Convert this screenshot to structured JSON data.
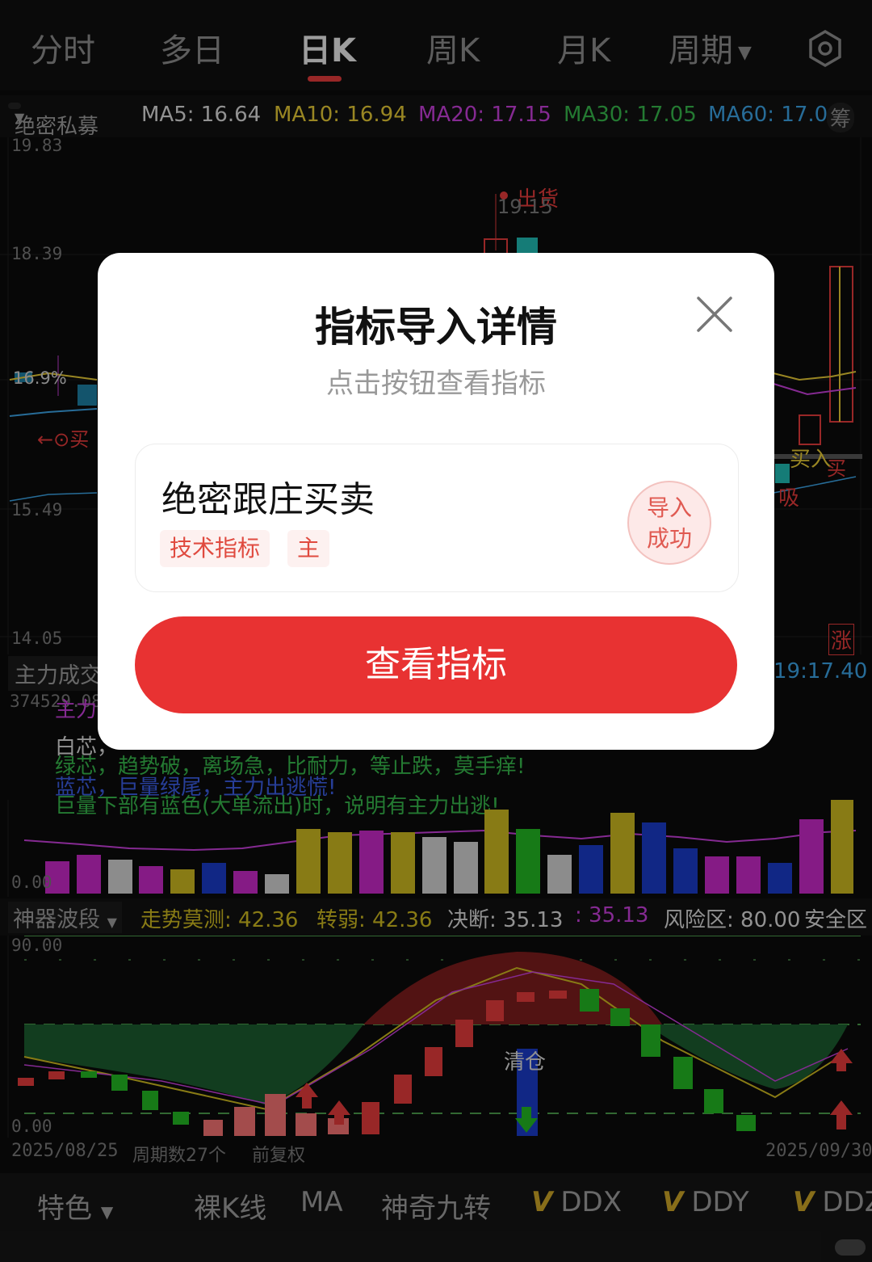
{
  "top_tabs": [
    {
      "label": "分时"
    },
    {
      "label": "多日"
    },
    {
      "label": "日K"
    },
    {
      "label": "周K"
    },
    {
      "label": "月K"
    },
    {
      "label": "周期"
    }
  ],
  "active_tab": "日K",
  "indicator_row": {
    "selector": "绝密私募",
    "ma5": "MA5: 16.64",
    "ma10": "MA10: 16.94",
    "ma20": "MA20: 17.15",
    "ma30": "MA30: 17.05",
    "ma60": "MA60: 17.0",
    "chip": "筹"
  },
  "price_axis": [
    "19.83",
    "18.39",
    "15.49",
    "14.05"
  ],
  "price_annotations": {
    "sell_top": "出货",
    "high_price": "19.15",
    "buy_left": "←⊙买",
    "buy_right": "买入",
    "buy_right2": "买",
    "absorb": "吸",
    "rise_icon": "涨",
    "left_price": "16.9%"
  },
  "volume_panel": {
    "title": "主力成交",
    "value_left": "374529.08",
    "time_right": "19:17.40",
    "zero_label": "0.00",
    "legend_lines": [
      "主力 粉芯",
      "白芯，",
      "绿芯，趋势破，离场急，比耐力，等止跌，莫手痒!",
      "蓝芯，巨量绿尾，主力出逃慌!",
      "巨量下部有蓝色(大单流出)时，说明有主力出逃!"
    ]
  },
  "wave_panel": {
    "selector": "神器波段",
    "items": [
      "走势莫测: 42.36",
      "转弱: 42.36",
      "决断: 35.13",
      ": 35.13",
      "风险区: 80.00",
      "安全区"
    ],
    "axis_top": "90.00",
    "axis_bottom": "0.00",
    "clear_label": "清仓"
  },
  "date_row": {
    "start": "2025/08/25",
    "period_count": "周期数27个",
    "adjust": "前复权",
    "end": "2025/09/30"
  },
  "bottom_bar": {
    "feature": "特色",
    "items": [
      "裸K线",
      "MA",
      "神奇九转"
    ],
    "v_items": [
      "DDX",
      "DDY",
      "DDZ"
    ],
    "v_mark": "V"
  },
  "modal": {
    "title": "指标导入详情",
    "subtitle": "点击按钮查看指标",
    "indicator_name": "绝密跟庄买卖",
    "tags": [
      "技术指标",
      "主"
    ],
    "status_line1": "导入",
    "status_line2": "成功",
    "view_button": "查看指标"
  },
  "colors": {
    "accent_red": "#e83232",
    "ma5": "#d8d8d8",
    "ma10": "#e2c634",
    "ma20": "#c43ed8",
    "ma30": "#35b44a",
    "ma60": "#3aa0e0"
  }
}
